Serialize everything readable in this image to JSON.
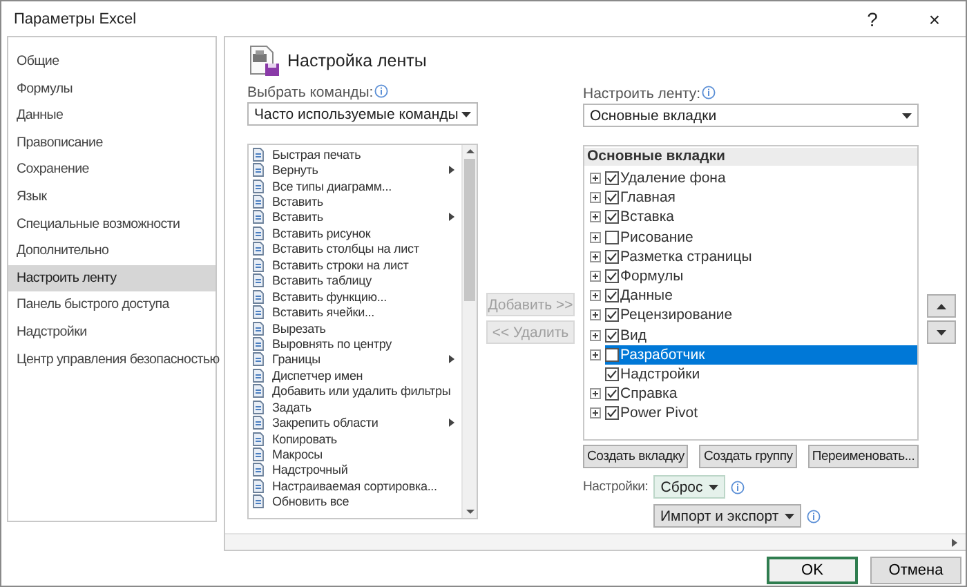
{
  "window": {
    "title": "Параметры Excel",
    "help": "?",
    "close": "×"
  },
  "sidebar": {
    "items": [
      {
        "label": "Общие",
        "selected": false
      },
      {
        "label": "Формулы",
        "selected": false
      },
      {
        "label": "Данные",
        "selected": false
      },
      {
        "label": "Правописание",
        "selected": false
      },
      {
        "label": "Сохранение",
        "selected": false
      },
      {
        "label": "Язык",
        "selected": false
      },
      {
        "label": "Специальные возможности",
        "selected": false
      },
      {
        "label": "Дополнительно",
        "selected": false
      },
      {
        "label": "Настроить ленту",
        "selected": true
      },
      {
        "label": "Панель быстрого доступа",
        "selected": false
      },
      {
        "label": "Надстройки",
        "selected": false
      },
      {
        "label": "Центр управления безопасностью",
        "selected": false
      }
    ]
  },
  "page": {
    "heading": "Настройка ленты"
  },
  "commands": {
    "label": "Выбрать команды:",
    "dropdown": "Часто используемые команды",
    "items": [
      {
        "label": "Быстрая печать",
        "submenu": false
      },
      {
        "label": "Вернуть",
        "submenu": true
      },
      {
        "label": "Все типы диаграмм...",
        "submenu": false
      },
      {
        "label": "Вставить",
        "submenu": false
      },
      {
        "label": "Вставить",
        "submenu": true
      },
      {
        "label": "Вставить рисунок",
        "submenu": false
      },
      {
        "label": "Вставить столбцы на лист",
        "submenu": false
      },
      {
        "label": "Вставить строки на лист",
        "submenu": false
      },
      {
        "label": "Вставить таблицу",
        "submenu": false
      },
      {
        "label": "Вставить функцию...",
        "submenu": false
      },
      {
        "label": "Вставить ячейки...",
        "submenu": false
      },
      {
        "label": "Вырезать",
        "submenu": false
      },
      {
        "label": "Выровнять по центру",
        "submenu": false
      },
      {
        "label": "Границы",
        "submenu": true
      },
      {
        "label": "Диспетчер имен",
        "submenu": false
      },
      {
        "label": "Добавить или удалить фильтры",
        "submenu": false
      },
      {
        "label": "Задать",
        "submenu": false
      },
      {
        "label": "Закрепить области",
        "submenu": true
      },
      {
        "label": "Копировать",
        "submenu": false
      },
      {
        "label": "Макросы",
        "submenu": false
      },
      {
        "label": "Надстрочный",
        "submenu": false
      },
      {
        "label": "Настраиваемая сортировка...",
        "submenu": false
      },
      {
        "label": "Обновить все",
        "submenu": false
      }
    ]
  },
  "transfer_buttons": [
    {
      "label": "Добавить >>",
      "disabled": true
    },
    {
      "label": "<< Удалить",
      "disabled": true
    }
  ],
  "ribbon": {
    "label": "Настроить ленту:",
    "dropdown": "Основные вкладки",
    "tree_header": "Основные вкладки",
    "tabs": [
      {
        "label": "Удаление фона",
        "checked": true,
        "expandable": true,
        "selected": false
      },
      {
        "label": "Главная",
        "checked": true,
        "expandable": true,
        "selected": false
      },
      {
        "label": "Вставка",
        "checked": true,
        "expandable": true,
        "selected": false
      },
      {
        "label": "Рисование",
        "checked": false,
        "expandable": true,
        "selected": false
      },
      {
        "label": "Разметка страницы",
        "checked": true,
        "expandable": true,
        "selected": false
      },
      {
        "label": "Формулы",
        "checked": true,
        "expandable": true,
        "selected": false
      },
      {
        "label": "Данные",
        "checked": true,
        "expandable": true,
        "selected": false
      },
      {
        "label": "Рецензирование",
        "checked": true,
        "expandable": true,
        "selected": false
      },
      {
        "label": "Вид",
        "checked": true,
        "expandable": true,
        "selected": false
      },
      {
        "label": "Разработчик",
        "checked": false,
        "expandable": true,
        "selected": true
      },
      {
        "label": "Надстройки",
        "checked": true,
        "expandable": false,
        "selected": false
      },
      {
        "label": "Справка",
        "checked": true,
        "expandable": true,
        "selected": false
      },
      {
        "label": "Power Pivot",
        "checked": true,
        "expandable": true,
        "selected": false
      }
    ],
    "buttons": [
      "Создать вкладку",
      "Создать группу",
      "Переименовать..."
    ],
    "settings_label": "Настройки:",
    "reset_button": "Сброс",
    "import_export_button": "Импорт и экспорт"
  },
  "footer": {
    "ok": "OK",
    "cancel": "Отмена"
  }
}
